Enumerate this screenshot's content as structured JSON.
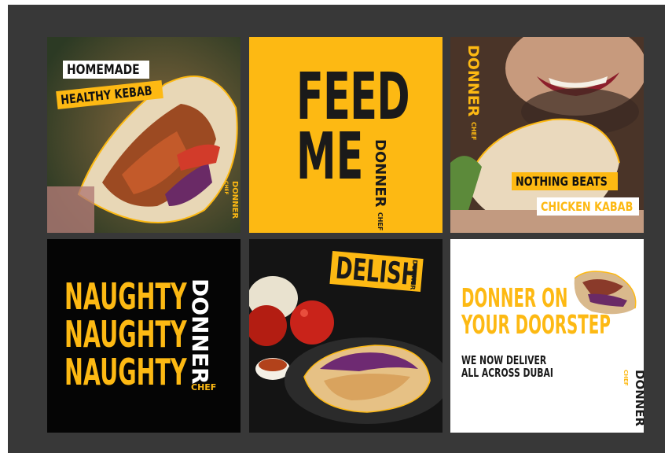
{
  "tiles": {
    "homemade": {
      "tag1": "HOMEMADE",
      "tag2": "HEALTHY KEBAB",
      "brand": "DONNER",
      "brand_sub": "CHEF"
    },
    "feed_me": {
      "line1": "FEED",
      "line2": "ME",
      "brand": "DONNER",
      "brand_sub": "CHEF"
    },
    "nothing_beats": {
      "brand": "DONNER",
      "brand_sub": "CHEF",
      "tag1": "NOTHING BEATS",
      "tag2": "CHICKEN KABAB"
    },
    "naughty": {
      "lines": [
        "NAUGHTY",
        "NAUGHTY",
        "NAUGHTY"
      ],
      "brand": "DONNER",
      "brand_sub": "CHEF"
    },
    "delish": {
      "title": "DELISH",
      "brand": "DONNER"
    },
    "doorstep": {
      "headline1": "DONNER ON",
      "headline2": "YOUR DOORSTEP",
      "sub1": "WE NOW DELIVER",
      "sub2": "ALL ACROSS DUBAI",
      "brand": "DONNER",
      "brand_sub": "CHEF"
    }
  },
  "colors": {
    "brand_yellow": "#fdb913",
    "ink": "#111111",
    "board": "#383838"
  }
}
